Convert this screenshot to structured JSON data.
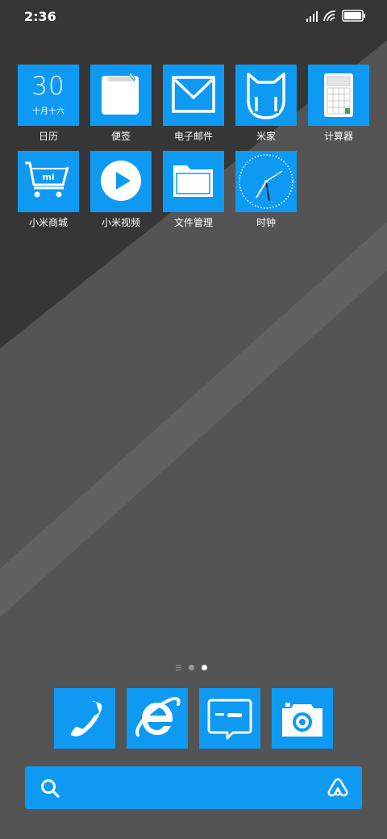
{
  "status_bar": {
    "time": "2:36",
    "icons": [
      "signal-icon",
      "wifi-icon",
      "battery-icon"
    ],
    "battery_level": 1.0
  },
  "apps": [
    {
      "label": "日历",
      "icon": "calendar-icon",
      "day": "30",
      "lunar": "十月十六"
    },
    {
      "label": "便签",
      "icon": "notes-icon"
    },
    {
      "label": "电子邮件",
      "icon": "mail-icon"
    },
    {
      "label": "米家",
      "icon": "mijia-icon"
    },
    {
      "label": "计算器",
      "icon": "calculator-icon"
    },
    {
      "label": "小米商城",
      "icon": "mi-store-icon",
      "logo_text": "mi"
    },
    {
      "label": "小米视频",
      "icon": "play-icon"
    },
    {
      "label": "文件管理",
      "icon": "folder-icon"
    },
    {
      "label": "时钟",
      "icon": "clock-icon"
    }
  ],
  "page_indicator": {
    "pages": 2,
    "current": 2
  },
  "dock": [
    {
      "icon": "phone-icon"
    },
    {
      "icon": "browser-icon"
    },
    {
      "icon": "messages-icon"
    },
    {
      "icon": "camera-icon"
    }
  ],
  "search_bar": {
    "left_icon": "search-icon",
    "right_icon": "assistant-icon"
  },
  "colors": {
    "icon_background": "#0E9AF2",
    "wallpaper_dark": "#363636",
    "wallpaper_mid": "#545454",
    "wallpaper_stripe": "#626262",
    "text": "#FFFFFF"
  }
}
